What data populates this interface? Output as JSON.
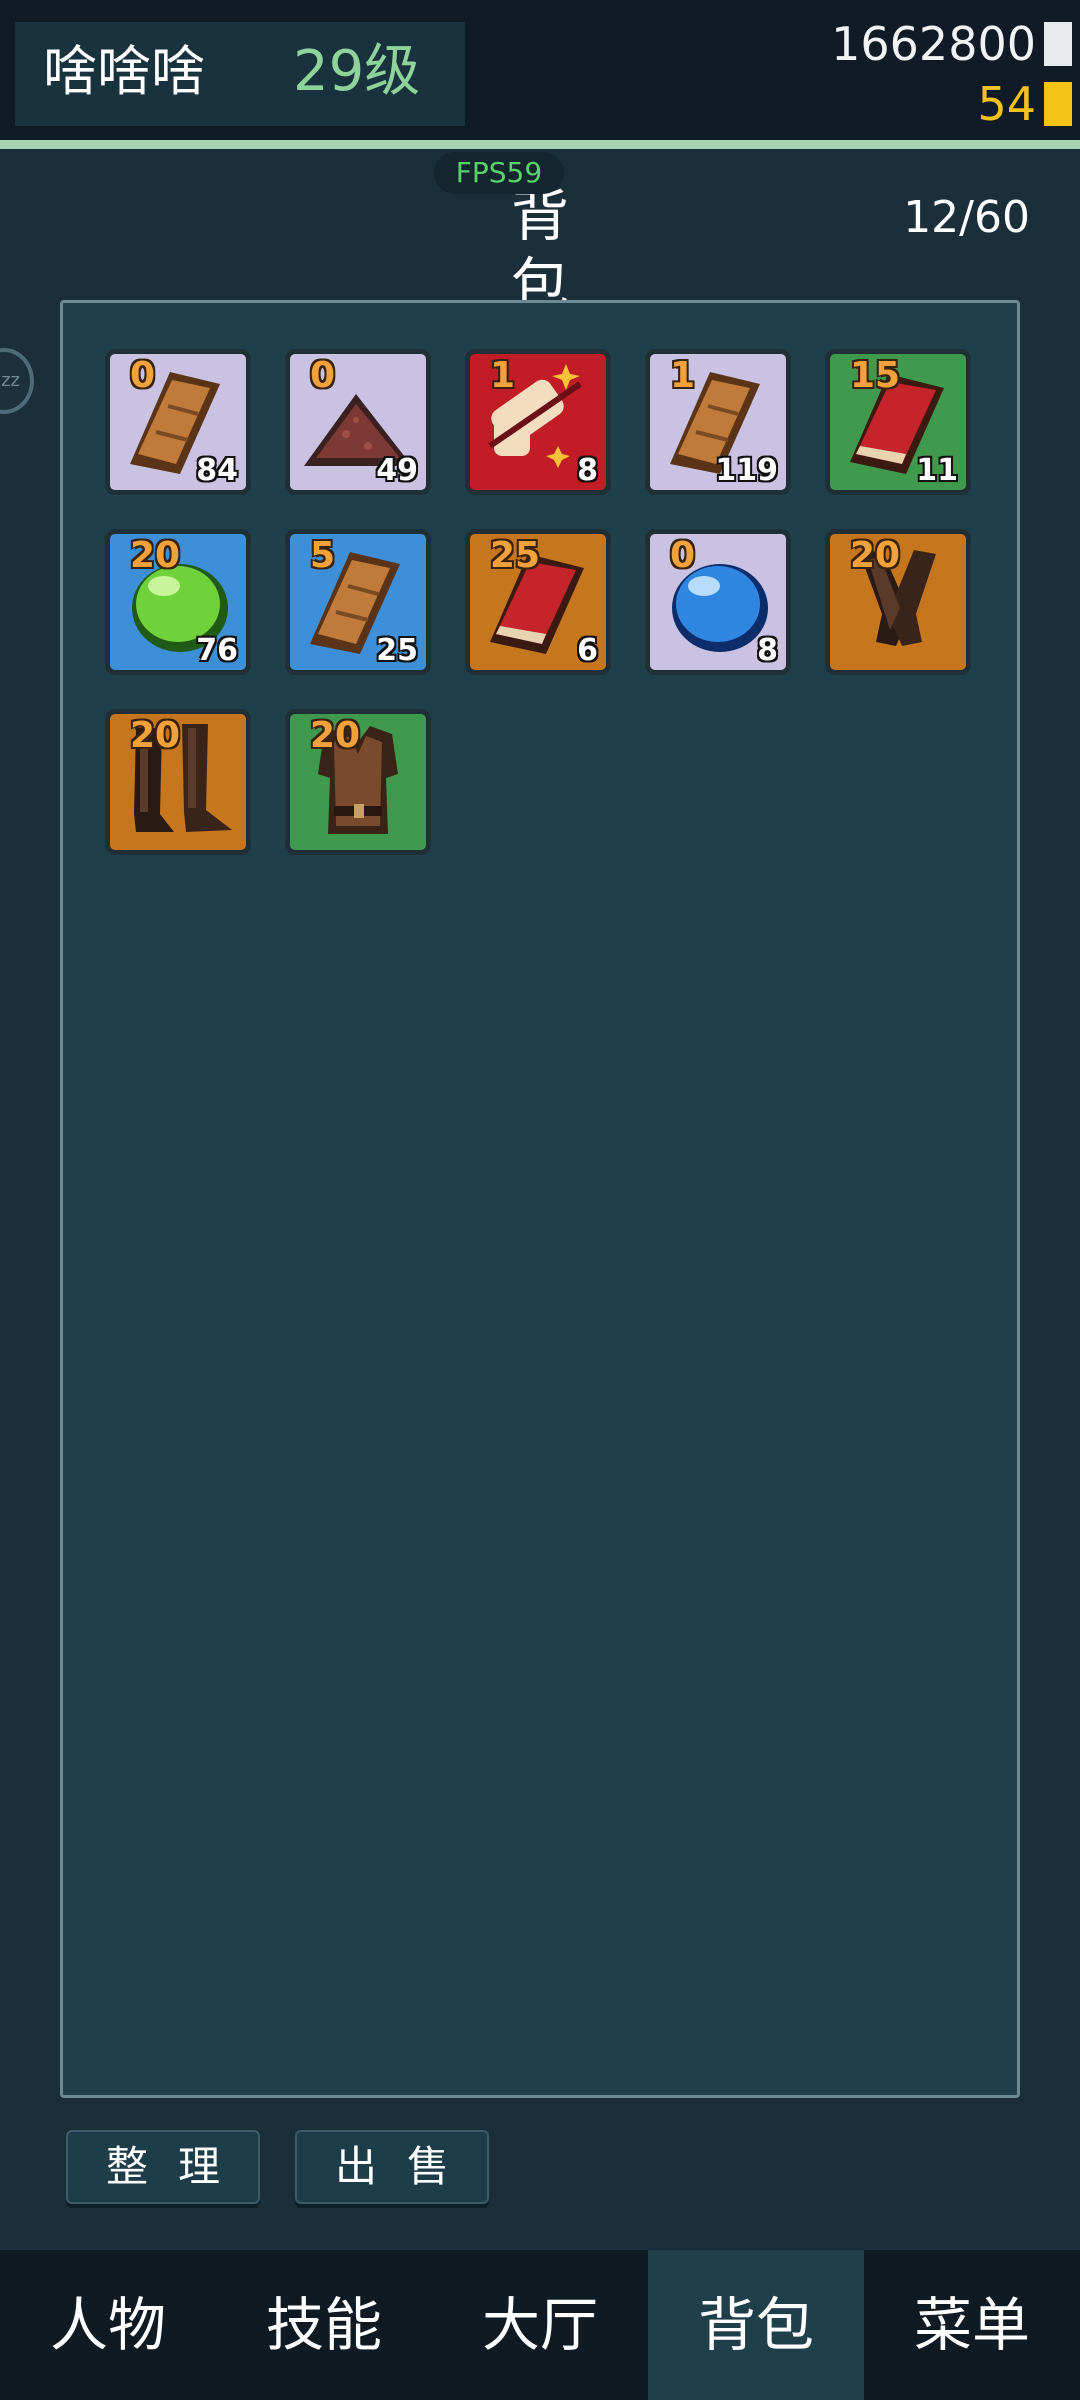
{
  "header": {
    "player_name": "啥啥啥",
    "level": "29级",
    "coins": "1662800",
    "gems": "54"
  },
  "fps": "FPS59",
  "page": {
    "title": "背包",
    "capacity": "12/60",
    "side_badge": "zz"
  },
  "inventory": [
    {
      "enhance": "0",
      "qty": "84",
      "icon": "leather-armor-icon",
      "rarity": "lavender"
    },
    {
      "enhance": "0",
      "qty": "49",
      "icon": "ore-pile-icon",
      "rarity": "lavender"
    },
    {
      "enhance": "1",
      "qty": "8",
      "icon": "scroll-icon",
      "rarity": "red"
    },
    {
      "enhance": "1",
      "qty": "119",
      "icon": "leather-armor-icon",
      "rarity": "lavender"
    },
    {
      "enhance": "15",
      "qty": "11",
      "icon": "red-book-icon",
      "rarity": "green"
    },
    {
      "enhance": "20",
      "qty": "76",
      "icon": "green-orb-icon",
      "rarity": "blue"
    },
    {
      "enhance": "5",
      "qty": "25",
      "icon": "leather-armor-icon",
      "rarity": "blue"
    },
    {
      "enhance": "25",
      "qty": "6",
      "icon": "red-book-icon",
      "rarity": "orange"
    },
    {
      "enhance": "0",
      "qty": "8",
      "icon": "blue-orb-icon",
      "rarity": "lavender"
    },
    {
      "enhance": "20",
      "qty": "",
      "icon": "gloves-icon",
      "rarity": "orange"
    },
    {
      "enhance": "20",
      "qty": "",
      "icon": "boots-icon",
      "rarity": "orange"
    },
    {
      "enhance": "20",
      "qty": "",
      "icon": "chest-armor-icon",
      "rarity": "green"
    }
  ],
  "actions": {
    "sort_label": "整理",
    "sell_label": "出售"
  },
  "nav": {
    "items": [
      "人物",
      "技能",
      "大厅",
      "背包",
      "菜单"
    ],
    "active": "背包"
  },
  "colors": {
    "background": "#1a2f3a",
    "panel": "#1f3f4b",
    "level_green": "#8fd39a",
    "gem_gold": "#f3c21b",
    "enhance_orange": "#f2a23a",
    "rarity_lavender": "#c9c2e3",
    "rarity_red": "#c21c26",
    "rarity_green": "#3f9a4d",
    "rarity_blue": "#3d8fd8",
    "rarity_orange": "#c6761d"
  }
}
